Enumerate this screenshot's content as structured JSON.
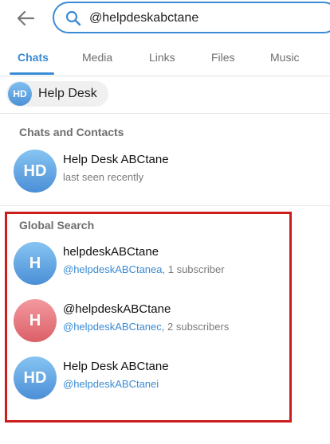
{
  "search": {
    "value": "@helpdeskabctane",
    "accent_color": "#3a8bd4"
  },
  "header": {
    "back_icon": "arrow-left-icon",
    "search_icon": "magnifier-icon"
  },
  "tabs": [
    {
      "label": "Chats",
      "active": true
    },
    {
      "label": "Media",
      "active": false
    },
    {
      "label": "Links",
      "active": false
    },
    {
      "label": "Files",
      "active": false
    },
    {
      "label": "Music",
      "active": false
    }
  ],
  "chip": {
    "initials": "HD",
    "label": "Help Desk"
  },
  "sections": {
    "chats_contacts": {
      "title": "Chats and Contacts",
      "items": [
        {
          "initials": "HD",
          "name": "Help Desk ABCtane",
          "status": "last seen recently"
        }
      ]
    },
    "global_search": {
      "title": "Global Search",
      "highlight_color": "#cc1d1d",
      "items": [
        {
          "initials": "H",
          "name": "helpdeskABCtane",
          "handle": "@helpdeskABCtanea",
          "extra": ", 1 subscriber",
          "color": "blue"
        },
        {
          "initials": "H",
          "name": "@helpdeskABCtane",
          "handle": "@helpdeskABCtanec",
          "extra": ", 2 subscribers",
          "color": "red"
        },
        {
          "initials": "HD",
          "name": "Help Desk ABCtane",
          "handle": "@helpdeskABCtanei",
          "extra": "",
          "color": "blue"
        }
      ]
    }
  }
}
